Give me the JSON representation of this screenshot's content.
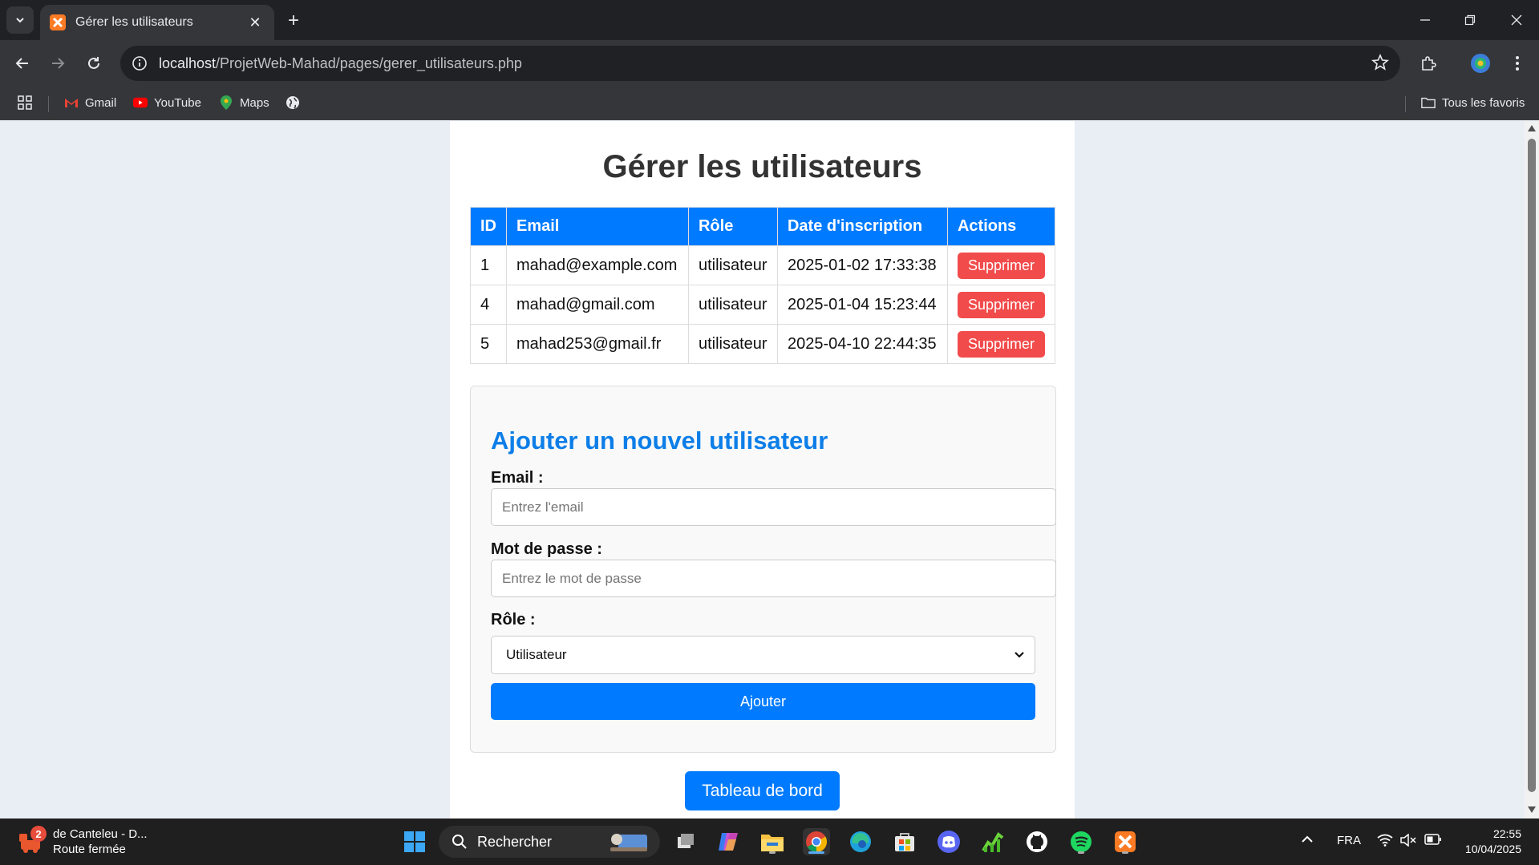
{
  "browser": {
    "tab_title": "Gérer les utilisateurs",
    "url_host": "localhost",
    "url_path": "/ProjetWeb-Mahad/pages/gerer_utilisateurs.php",
    "bookmarks": [
      "Gmail",
      "YouTube",
      "Maps"
    ],
    "all_bookmarks_label": "Tous les favoris"
  },
  "page": {
    "title": "Gérer les utilisateurs",
    "table": {
      "headers": [
        "ID",
        "Email",
        "Rôle",
        "Date d'inscription",
        "Actions"
      ],
      "rows": [
        {
          "id": "1",
          "email": "mahad@example.com",
          "role": "utilisateur",
          "date": "2025-01-02 17:33:38",
          "action": "Supprimer"
        },
        {
          "id": "4",
          "email": "mahad@gmail.com",
          "role": "utilisateur",
          "date": "2025-01-04 15:23:44",
          "action": "Supprimer"
        },
        {
          "id": "5",
          "email": "mahad253@gmail.fr",
          "role": "utilisateur",
          "date": "2025-04-10 22:44:35",
          "action": "Supprimer"
        }
      ]
    },
    "form": {
      "title": "Ajouter un nouvel utilisateur",
      "email_label": "Email :",
      "email_placeholder": "Entrez l'email",
      "password_label": "Mot de passe :",
      "password_placeholder": "Entrez le mot de passe",
      "role_label": "Rôle :",
      "role_selected": "Utilisateur",
      "submit_label": "Ajouter"
    },
    "dashboard_button": "Tableau de bord"
  },
  "taskbar": {
    "news_title": "de Canteleu - D...",
    "news_subtitle": "Route fermée",
    "news_badge": "2",
    "search_label": "Rechercher",
    "language": "FRA",
    "time": "22:55",
    "date": "10/04/2025"
  },
  "colors": {
    "primary": "#007bff",
    "danger": "#f24b4b",
    "form_title": "#0d7ee8"
  }
}
